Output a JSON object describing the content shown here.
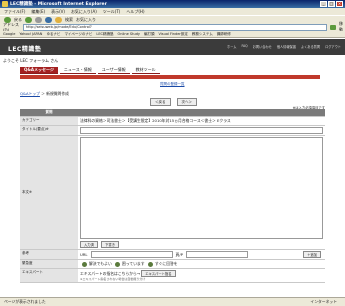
{
  "window": {
    "title": "LEC精識塾 - Microsoft Internet Explorer",
    "controls": [
      "_",
      "□",
      "×"
    ]
  },
  "menu": [
    "ファイル(F)",
    "編集(E)",
    "表示(V)",
    "お気に入り(A)",
    "ツール(T)",
    "ヘルプ(H)"
  ],
  "toolbar": {
    "back": "戻る",
    "search": "検索",
    "favorites": "お気に入り"
  },
  "address": {
    "label": "アドレス(D)",
    "value": "http://seisuweb.jp/mode/Edu/Control?",
    "go": "移動"
  },
  "links": [
    "Google",
    "Yahoo! JAPAN",
    "ゆるナビ",
    "マイページのナビ",
    "LEC精識塾",
    "Online Study",
    "編打頭",
    "Visual Finder設定",
    "教務システム",
    "講師研修"
  ],
  "banner": {
    "logo": "LEC精識塾",
    "links": [
      "ホーム",
      "FAQ",
      "お問い合わせ",
      "個人情報保護",
      "よくある質問",
      "ログアウト"
    ]
  },
  "welcome": "ようこそ LEC フォーラム さん",
  "tabs": [
    "Q&Aメッセージ",
    "ニュース・情報",
    "ユーザー情報",
    "教材ツール"
  ],
  "sublink": "質問の登録一覧",
  "breadcrumb": {
    "link": "Q&Aトップ",
    "current": "新規質問作成"
  },
  "nav_buttons": {
    "back": "＜戻る",
    "next": "次へ＞"
  },
  "form": {
    "required_note": "※は入力必須項目です",
    "header_label": "質問",
    "rows": {
      "course": {
        "label": "カテゴリー",
        "value": "法律科の資格＞司法書士＞【受講生限定】2010年対15ヵ月合格コース＜書士＞ Eクラス"
      },
      "title": {
        "label": "タイトル(要点)※"
      },
      "body": {
        "label": "本文※",
        "btn1": "入力済",
        "btn2": "下書き"
      },
      "ref": {
        "label": "参考",
        "url_label": "URL",
        "page_label": "頁/P",
        "add": "＋追加"
      },
      "urgency": {
        "label": "緊急度",
        "opt1": "解決でもよい",
        "opt2": "困っています",
        "opt3": "すぐに回答を"
      },
      "expert": {
        "label": "エキスパート",
        "text": "エキスパートの指名はこちらから→",
        "button": "エキスパート指名",
        "note": "※エキスパート指名されない場合は自動振り分け"
      }
    }
  },
  "status": {
    "left": "ページが表示されました",
    "zone": "インターネット"
  }
}
